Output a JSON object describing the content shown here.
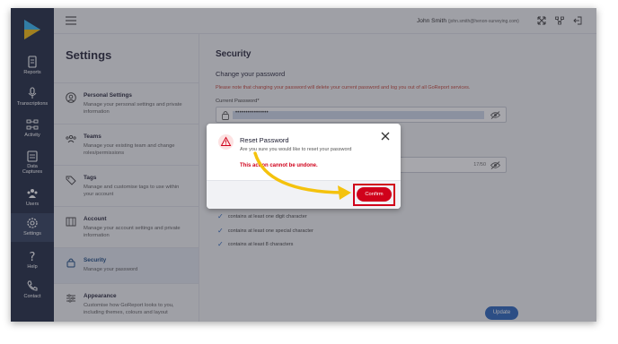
{
  "sidebar": {
    "items": [
      {
        "label": "Reports",
        "icon": "document-icon"
      },
      {
        "label": "Transcriptions",
        "icon": "microphone-icon"
      },
      {
        "label": "Activity",
        "icon": "activity-icon"
      },
      {
        "label": "Data Captures",
        "icon": "clipboard-icon"
      },
      {
        "label": "Users",
        "icon": "users-icon"
      },
      {
        "label": "Settings",
        "icon": "gear-icon"
      },
      {
        "label": "Help",
        "icon": "question-icon"
      },
      {
        "label": "Contact",
        "icon": "phone-icon"
      }
    ]
  },
  "topbar": {
    "user_name": "John Smith",
    "user_email": "(john.smith@henon-surveying.com)"
  },
  "settings": {
    "title": "Settings",
    "items": [
      {
        "title": "Personal Settings",
        "desc": "Manage your personal settings and private information"
      },
      {
        "title": "Teams",
        "desc": "Manage your existing team and change roles/permissions"
      },
      {
        "title": "Tags",
        "desc": "Manage and customise tags to use within your account"
      },
      {
        "title": "Account",
        "desc": "Manage your account settings and private information"
      },
      {
        "title": "Security",
        "desc": "Manage your password"
      },
      {
        "title": "Appearance",
        "desc": "Customise how GoReport looks to you, including themes, colours and layout"
      }
    ]
  },
  "security": {
    "title": "Security",
    "subtitle": "Change your password",
    "warning": "Please note that changing your password will delete your current password and log you out of all GoReport services.",
    "current_label": "Current Password*",
    "current_value": "••••••••••••••••",
    "counter": "17/50",
    "requirements": [
      "contains at least one digit character",
      "contains at least one special character",
      "contains at least 8 characters"
    ],
    "update_label": "Update"
  },
  "modal": {
    "title": "Reset Password",
    "text": "Are you sure you would like to reset your password",
    "bold_text": "This action cannot be undone.",
    "confirm_label": "Confirm"
  },
  "colors": {
    "sidebar": "#14203a",
    "accent": "#1f5db8",
    "danger": "#d0021b",
    "arrow": "#f4c20d"
  }
}
